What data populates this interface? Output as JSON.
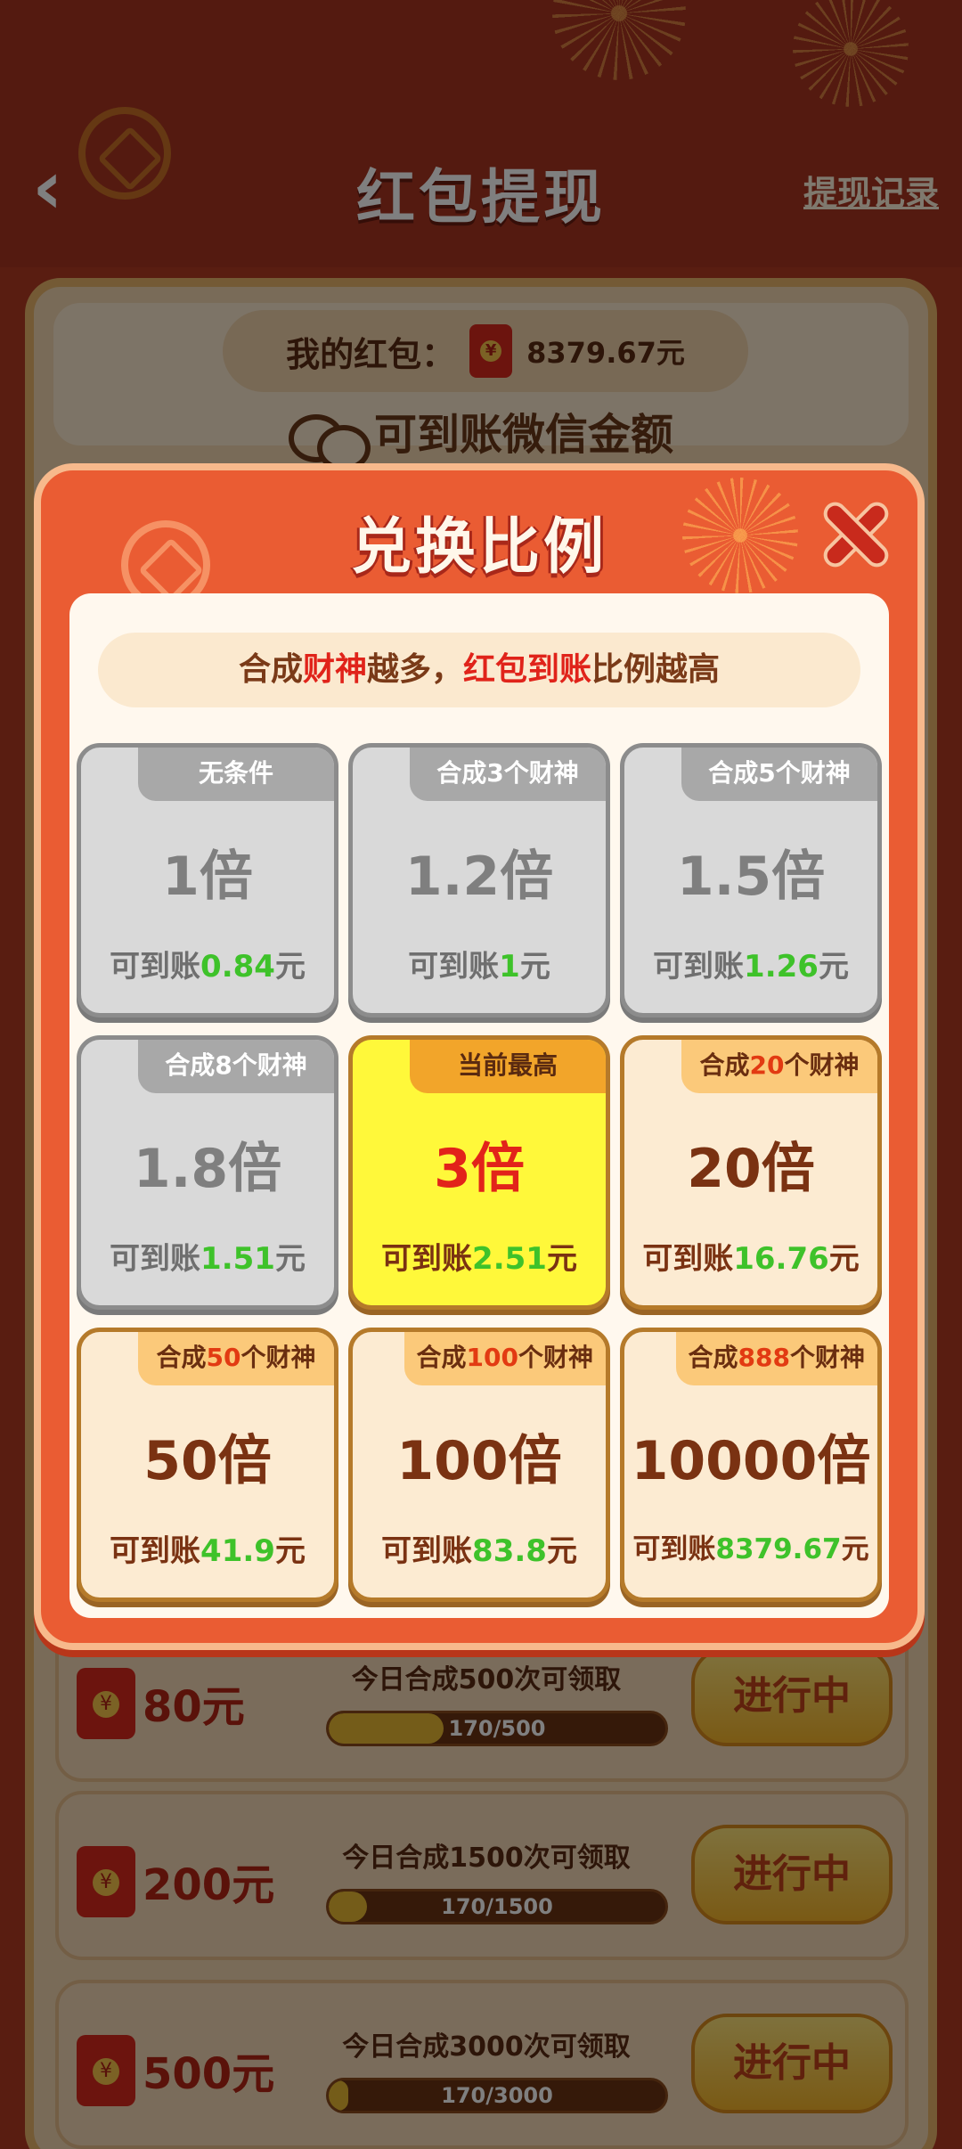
{
  "header": {
    "title": "红包提现",
    "history_label": "提现记录"
  },
  "balance": {
    "label": "我的红包：",
    "amount": "8379.67元"
  },
  "wechat_line": "可到账微信金额",
  "tasks": [
    {
      "amount": "80元",
      "desc": "今日合成500次可领取",
      "progress_text": "170/500",
      "progress": 0.34,
      "button": "进行中"
    },
    {
      "amount": "200元",
      "desc": "今日合成1500次可领取",
      "progress_text": "170/1500",
      "progress": 0.113,
      "button": "进行中"
    },
    {
      "amount": "500元",
      "desc": "今日合成3000次可领取",
      "progress_text": "170/3000",
      "progress": 0.057,
      "button": "进行中"
    }
  ],
  "modal": {
    "title": "兑换比例",
    "hint": {
      "p1": "合成",
      "h1": "财神",
      "p2": "越多，",
      "h2": "红包到账",
      "p3": "比例越高"
    },
    "tiles": [
      {
        "state": "grey",
        "tag": "无条件",
        "multiplier": "1倍",
        "payout_prefix": "可到账",
        "payout_value": "0.84",
        "payout_suffix": "元"
      },
      {
        "state": "grey",
        "tag_pre": "合成",
        "tag_num": "3",
        "tag_post": "个财神",
        "multiplier": "1.2倍",
        "payout_prefix": "可到账",
        "payout_value": "1",
        "payout_suffix": "元"
      },
      {
        "state": "grey",
        "tag_pre": "合成",
        "tag_num": "5",
        "tag_post": "个财神",
        "multiplier": "1.5倍",
        "payout_prefix": "可到账",
        "payout_value": "1.26",
        "payout_suffix": "元"
      },
      {
        "state": "grey",
        "tag_pre": "合成",
        "tag_num": "8",
        "tag_post": "个财神",
        "multiplier": "1.8倍",
        "payout_prefix": "可到账",
        "payout_value": "1.51",
        "payout_suffix": "元"
      },
      {
        "state": "current",
        "tag": "当前最高",
        "multiplier": "3倍",
        "payout_prefix": "可到账",
        "payout_value": "2.51",
        "payout_suffix": "元"
      },
      {
        "state": "future",
        "tag_pre": "合成",
        "tag_num": "20",
        "tag_post": "个财神",
        "multiplier": "20倍",
        "payout_prefix": "可到账",
        "payout_value": "16.76",
        "payout_suffix": "元"
      },
      {
        "state": "future",
        "tag_pre": "合成",
        "tag_num": "50",
        "tag_post": "个财神",
        "multiplier": "50倍",
        "payout_prefix": "可到账",
        "payout_value": "41.9",
        "payout_suffix": "元"
      },
      {
        "state": "future",
        "tag_pre": "合成",
        "tag_num": "100",
        "tag_post": "个财神",
        "multiplier": "100倍",
        "payout_prefix": "可到账",
        "payout_value": "83.8",
        "payout_suffix": "元"
      },
      {
        "state": "future",
        "tag_pre": "合成",
        "tag_num": "888",
        "tag_post": "个财神",
        "multiplier": "10000倍",
        "payout_prefix": "可到账",
        "payout_value": "8379.67",
        "payout_suffix": "元"
      }
    ]
  }
}
